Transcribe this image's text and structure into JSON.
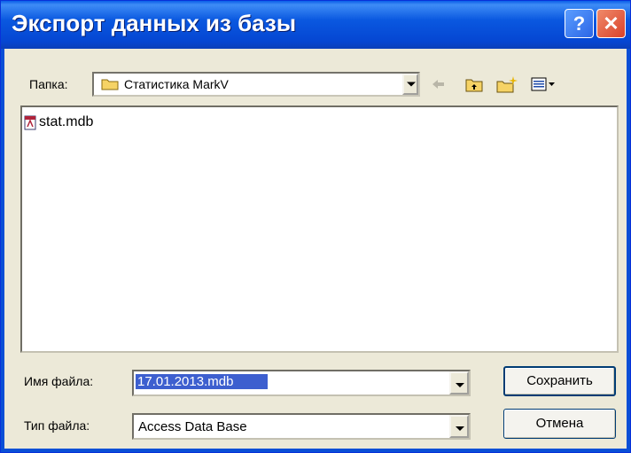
{
  "window": {
    "title": "Экспорт данных из базы",
    "help_label": "?",
    "close_label": "✕"
  },
  "folder": {
    "label": "Папка:",
    "value": "Статистика MarkV"
  },
  "toolbar": [
    "back-icon",
    "up-folder-icon",
    "new-folder-icon",
    "view-menu-icon"
  ],
  "files": [
    {
      "name": "stat.mdb",
      "icon": "access-db-icon"
    }
  ],
  "filename": {
    "label": "Имя файла:",
    "value": "17.01.2013.mdb"
  },
  "filetype": {
    "label": "Тип файла:",
    "value": "Access Data Base"
  },
  "buttons": {
    "save": "Сохранить",
    "cancel": "Отмена"
  },
  "colors": {
    "title_bar": "#0a58e0",
    "selection": "#3d5fcf",
    "dialog_bg": "#ece9d8"
  }
}
